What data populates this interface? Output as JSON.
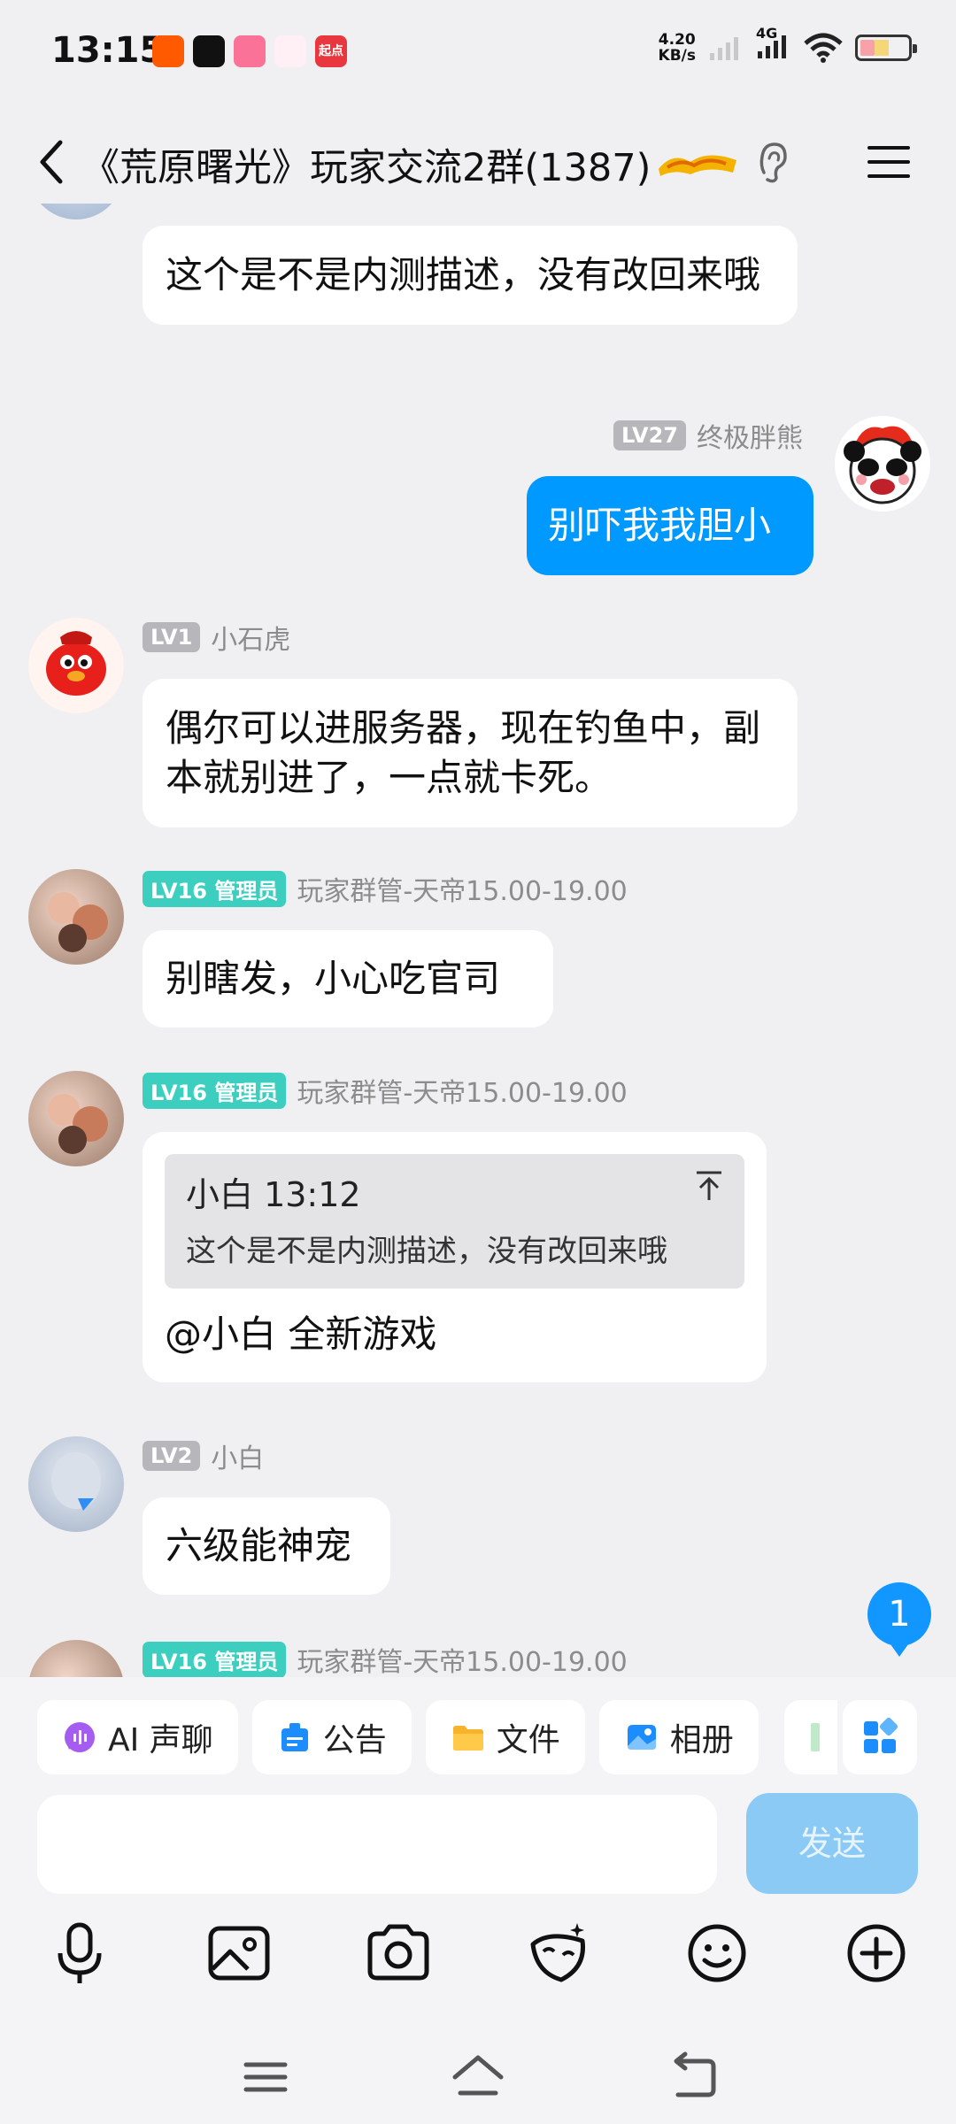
{
  "status": {
    "time": "13:15",
    "speed_value": "4.20",
    "speed_unit": "KB/s",
    "network": "4G",
    "app_icons": [
      "kuaishou-icon",
      "douyin-icon",
      "bilibili-icon",
      "crown-app-icon",
      "qidian-icon"
    ],
    "qidian_label": "起点"
  },
  "header": {
    "title": "《荒原曙光》玩家交流2群(1387)"
  },
  "messages": [
    {
      "text": "这个是不是内测描述，没有改回来哦"
    },
    {
      "level": "LV27",
      "name": "终极胖熊",
      "text": "别吓我我胆小"
    },
    {
      "level": "LV1",
      "name": "小石虎",
      "text": "偶尔可以进服务器，现在钓鱼中，副本就别进了，一点就卡死。"
    },
    {
      "level": "LV16 管理员",
      "name": "玩家群管-天帝15.00-19.00",
      "text": "别瞎发，小心吃官司"
    },
    {
      "level": "LV16 管理员",
      "name": "玩家群管-天帝15.00-19.00",
      "quote_header": "小白 13:12",
      "quote_text": "这个是不是内测描述，没有改回来哦",
      "text": "@小白 全新游戏"
    },
    {
      "level": "LV2",
      "name": "小白",
      "text": "六级能神宠"
    },
    {
      "level": "LV16 管理员",
      "name": "玩家群管-天帝15.00-19.00"
    }
  ],
  "unread_count": "1",
  "toolbar": {
    "items": [
      {
        "label": "AI 声聊",
        "icon": "ai-voice-icon"
      },
      {
        "label": "公告",
        "icon": "announcement-icon"
      },
      {
        "label": "文件",
        "icon": "folder-icon"
      },
      {
        "label": "相册",
        "icon": "album-icon"
      }
    ]
  },
  "input": {
    "send_label": "发送"
  },
  "colors": {
    "accent": "#0099ff",
    "admin_badge": "#3ccfc0",
    "level_badge": "#b6b6bb",
    "send_disabled": "#8ccaf6"
  }
}
